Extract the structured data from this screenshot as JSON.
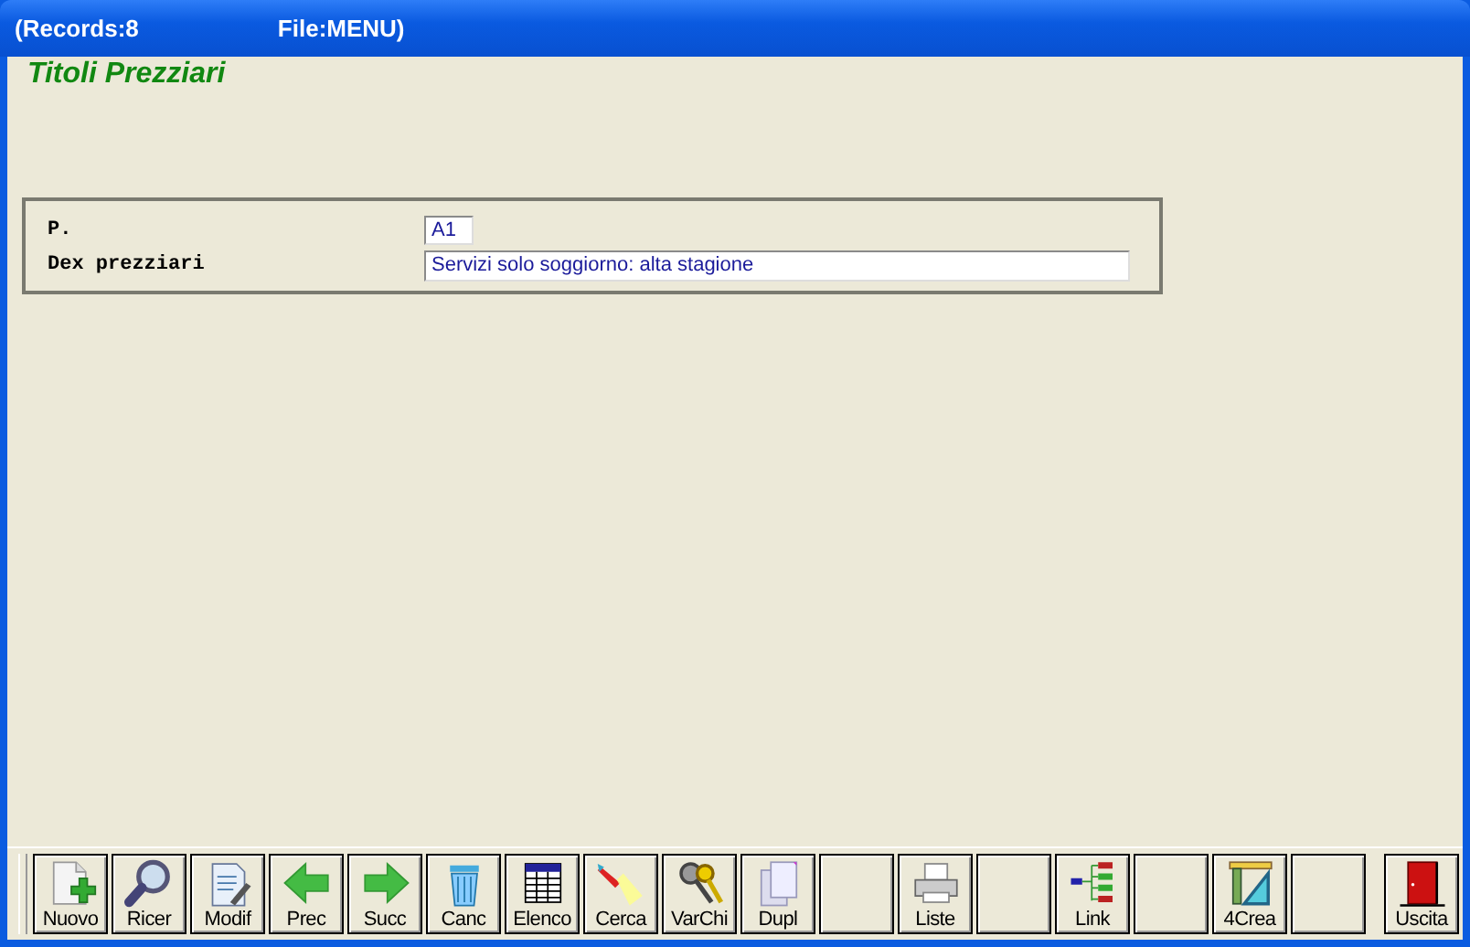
{
  "window": {
    "records": "(Records:8",
    "file": "File:MENU)"
  },
  "heading": "Titoli Prezziari",
  "form": {
    "fields": [
      {
        "label": "P.",
        "value": "A1"
      },
      {
        "label": "Dex prezziari",
        "value": "Servizi solo soggiorno: alta stagione"
      }
    ]
  },
  "toolbar": [
    {
      "kind": "new",
      "label": "Nuovo"
    },
    {
      "kind": "search",
      "label": "Ricer"
    },
    {
      "kind": "edit",
      "label": "Modif"
    },
    {
      "kind": "back",
      "label": "Prec"
    },
    {
      "kind": "forward",
      "label": "Succ"
    },
    {
      "kind": "trash",
      "label": "Canc"
    },
    {
      "kind": "table",
      "label": "Elenco"
    },
    {
      "kind": "flashlight",
      "label": "Cerca"
    },
    {
      "kind": "keys",
      "label": "VarChi"
    },
    {
      "kind": "copy",
      "label": "Dupl"
    },
    {
      "kind": "blank"
    },
    {
      "kind": "printer",
      "label": "Liste"
    },
    {
      "kind": "blank"
    },
    {
      "kind": "tree",
      "label": "Link"
    },
    {
      "kind": "blank"
    },
    {
      "kind": "ruler",
      "label": "4Crea"
    },
    {
      "kind": "blank"
    },
    {
      "kind": "door",
      "label": "Uscita"
    }
  ]
}
